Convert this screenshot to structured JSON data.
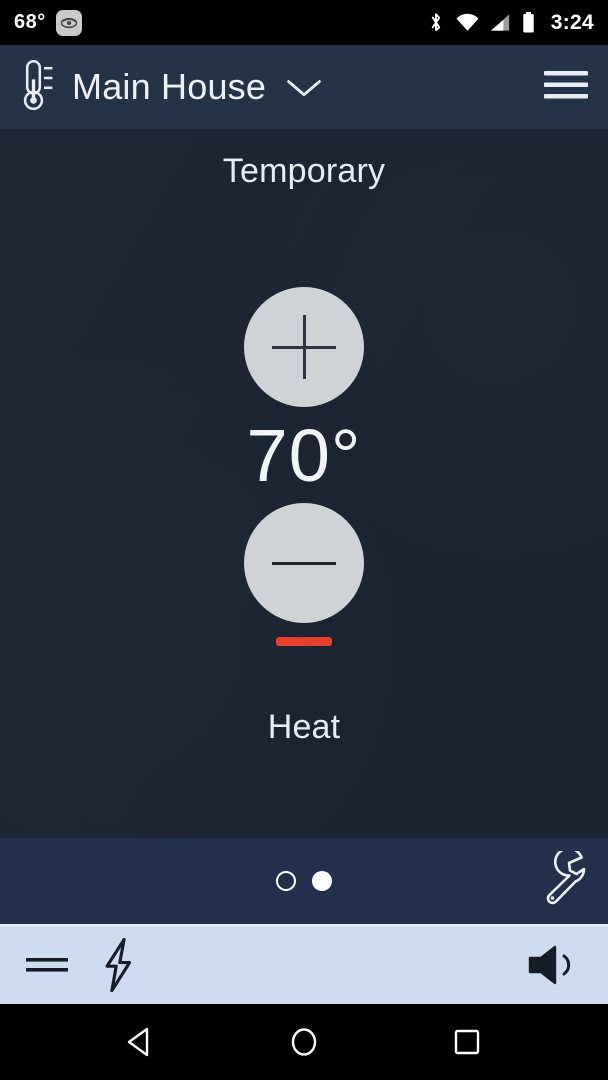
{
  "status_bar": {
    "outdoor_temp": "68°",
    "app_icon_name": "thermostat-app-icon",
    "clock": "3:24",
    "icons": [
      "bluetooth-icon",
      "wifi-icon",
      "cellular-signal-icon",
      "battery-icon"
    ]
  },
  "app_bar": {
    "thermometer_icon": "thermometer-icon",
    "title": "Main House",
    "dropdown_icon": "chevron-down-icon",
    "menu_icon": "hamburger-menu-icon"
  },
  "main": {
    "mode_label": "Temporary",
    "increase_icon": "plus-icon",
    "decrease_icon": "minus-icon",
    "temperature": "70°",
    "state_label": "Heat",
    "heat_indicator_color": "#e8412f"
  },
  "pager": {
    "dots": [
      {
        "name": "page-dot-1",
        "active": false
      },
      {
        "name": "page-dot-2",
        "active": true
      }
    ],
    "settings_icon": "wrench-icon"
  },
  "toolbar": {
    "items": [
      {
        "name": "equals-menu-icon"
      },
      {
        "name": "lightning-bolt-icon"
      },
      {
        "name": "volume-speaker-icon"
      }
    ]
  },
  "nav_bar": {
    "back_icon": "back-triangle-icon",
    "home_icon": "home-circle-icon",
    "recents_icon": "recents-square-icon"
  },
  "colors": {
    "content_bg": "#1b2433",
    "app_bar_bg": "#253349",
    "pager_bg": "#243150",
    "toolbar_bg": "#cfdcef",
    "accent_red": "#e8412f",
    "button_gray": "#cfd3d6"
  }
}
